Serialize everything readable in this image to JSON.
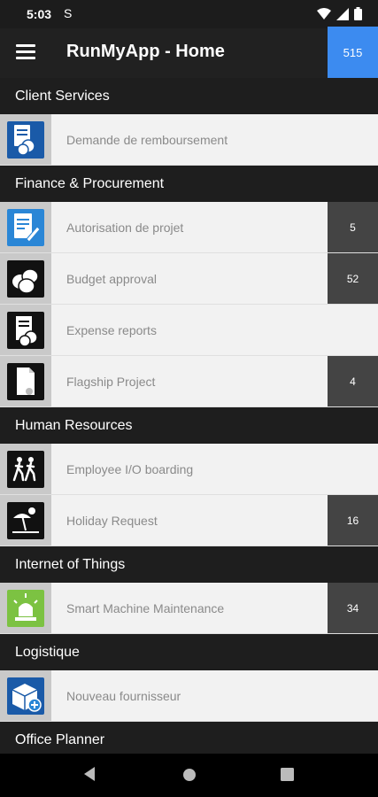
{
  "status": {
    "time": "5:03",
    "sync_glyph": "S"
  },
  "app": {
    "title": "RunMyApp - Home",
    "badge": "515"
  },
  "sections": [
    {
      "title": "Client Services",
      "items": [
        {
          "label": "Demande de remboursement",
          "badge": "",
          "icon": "document-coins-icon",
          "icon_bg": "#1a5aa8"
        }
      ]
    },
    {
      "title": "Finance & Procurement",
      "items": [
        {
          "label": "Autorisation de projet",
          "badge": "5",
          "icon": "document-pen-icon",
          "icon_bg": "#2a86d6"
        },
        {
          "label": "Budget approval",
          "badge": "52",
          "icon": "coins-icon",
          "icon_bg": "#111111"
        },
        {
          "label": "Expense reports",
          "badge": "",
          "icon": "receipt-coins-icon",
          "icon_bg": "#111111"
        },
        {
          "label": "Flagship Project",
          "badge": "4",
          "icon": "document-icon",
          "icon_bg": "#111111"
        }
      ]
    },
    {
      "title": "Human Resources",
      "items": [
        {
          "label": "Employee I/O boarding",
          "badge": "",
          "icon": "people-walking-icon",
          "icon_bg": "#111111"
        },
        {
          "label": "Holiday Request",
          "badge": "16",
          "icon": "beach-icon",
          "icon_bg": "#111111"
        }
      ]
    },
    {
      "title": "Internet of Things",
      "items": [
        {
          "label": "Smart Machine Maintenance",
          "badge": "34",
          "icon": "alarm-light-icon",
          "icon_bg": "#7cc242"
        }
      ]
    },
    {
      "title": "Logistique",
      "items": [
        {
          "label": "Nouveau fournisseur",
          "badge": "",
          "icon": "box-add-icon",
          "icon_bg": "#1a5aa8"
        }
      ]
    },
    {
      "title": "Office Planner",
      "items": []
    }
  ]
}
